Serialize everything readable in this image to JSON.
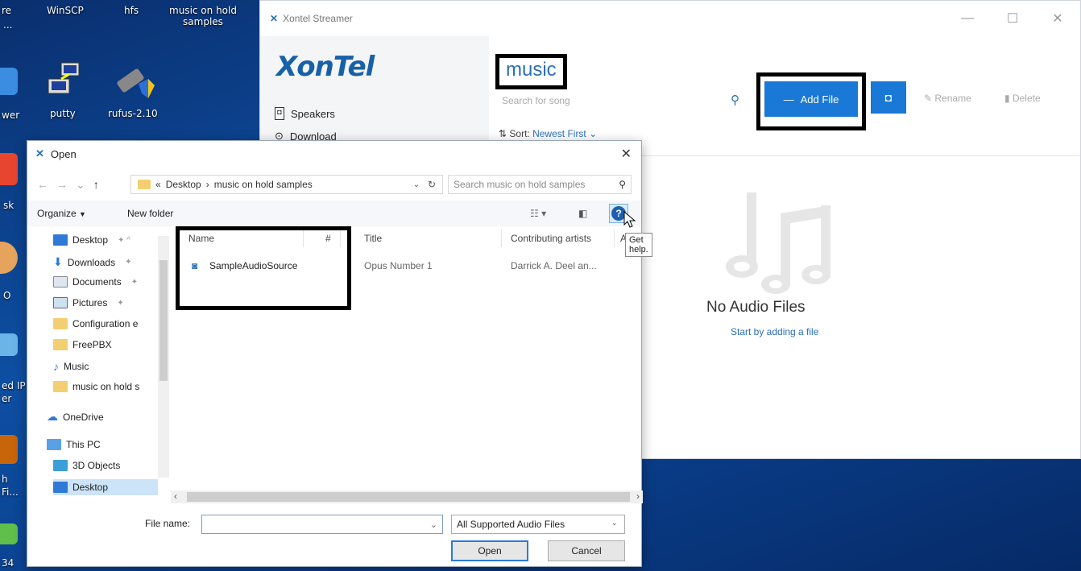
{
  "desktop": {
    "icons": [
      {
        "label": "WinSCP"
      },
      {
        "label": "hfs"
      },
      {
        "label": "music on hold samples"
      },
      {
        "label": "putty"
      },
      {
        "label": "rufus-2.10"
      }
    ],
    "partial_labels": [
      "re",
      "...",
      "wer",
      "sk",
      "O",
      "ed IP",
      "er",
      "h",
      "Fi...",
      "34"
    ]
  },
  "xontel": {
    "window_title": "Xontel Streamer",
    "logo_text": "XonTel",
    "nav": [
      {
        "label": "Speakers"
      },
      {
        "label": "Download"
      }
    ],
    "page_title": "music",
    "search_placeholder": "Search for song",
    "sort_label": "Sort:",
    "sort_value": "Newest First",
    "add_file_label": "Add File",
    "rename_label": "Rename",
    "delete_label": "Delete",
    "empty_title": "No Audio Files",
    "empty_link": "Start by adding a file",
    "colors": {
      "accent": "#1a78d6",
      "link": "#2a6fb8"
    }
  },
  "dialog": {
    "title": "Open",
    "breadcrumb": [
      "Desktop",
      "music on hold samples"
    ],
    "breadcrumb_prefix": "«",
    "search_placeholder": "Search music on hold samples",
    "organize_label": "Organize",
    "new_folder_label": "New folder",
    "nav_items": [
      {
        "label": "Desktop",
        "pinned": true
      },
      {
        "label": "Downloads",
        "pinned": true
      },
      {
        "label": "Documents",
        "pinned": true
      },
      {
        "label": "Pictures",
        "pinned": true
      },
      {
        "label": "Configuration e"
      },
      {
        "label": "FreePBX"
      },
      {
        "label": "Music"
      },
      {
        "label": "music on hold s"
      },
      {
        "label": "OneDrive"
      },
      {
        "label": "This PC"
      },
      {
        "label": "3D Objects"
      },
      {
        "label": "Desktop"
      }
    ],
    "columns": [
      "Name",
      "#",
      "Title",
      "Contributing artists",
      "A"
    ],
    "files": [
      {
        "name": "SampleAudioSource",
        "track": "",
        "title": "Opus Number 1",
        "artists": "Darrick A. Deel an..."
      }
    ],
    "tooltip": "Get help.",
    "file_name_label": "File name:",
    "file_name_value": "",
    "file_type": "All Supported Audio Files",
    "open_label": "Open",
    "cancel_label": "Cancel"
  }
}
